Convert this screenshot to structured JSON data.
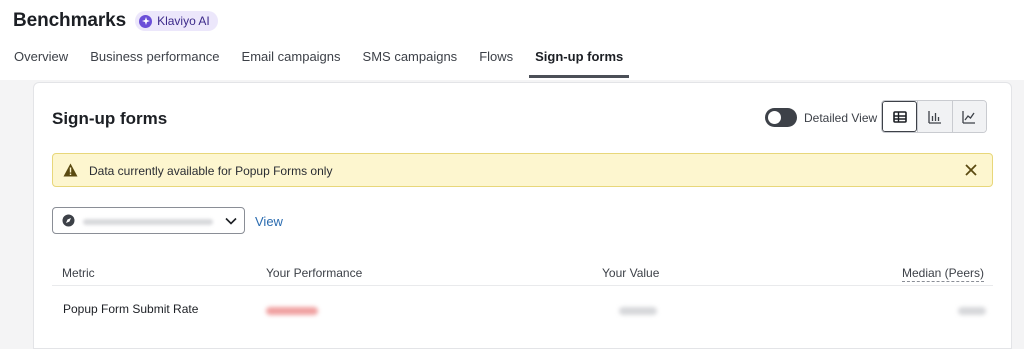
{
  "header": {
    "title": "Benchmarks",
    "ai_badge": "Klaviyo AI"
  },
  "tabs": [
    {
      "label": "Overview",
      "active": false
    },
    {
      "label": "Business performance",
      "active": false
    },
    {
      "label": "Email campaigns",
      "active": false
    },
    {
      "label": "SMS campaigns",
      "active": false
    },
    {
      "label": "Flows",
      "active": false
    },
    {
      "label": "Sign-up forms",
      "active": true
    }
  ],
  "card": {
    "title": "Sign-up forms",
    "toggle_label": "Detailed View",
    "toggle_on": true,
    "view_modes": [
      "table-icon",
      "bar-chart-icon",
      "line-chart-icon"
    ],
    "alert": {
      "text": "Data currently available for Popup Forms only"
    },
    "select": {
      "icon": "globe-icon"
    },
    "view_link": "View",
    "table": {
      "headers": {
        "metric": "Metric",
        "performance": "Your Performance",
        "value": "Your Value",
        "median": "Median (Peers)"
      },
      "rows": [
        {
          "metric": "Popup Form Submit Rate"
        }
      ]
    }
  },
  "colors": {
    "accent_ai": "#6b4fd8",
    "alert_bg": "#fdf6cf",
    "link": "#2b6cb0"
  }
}
